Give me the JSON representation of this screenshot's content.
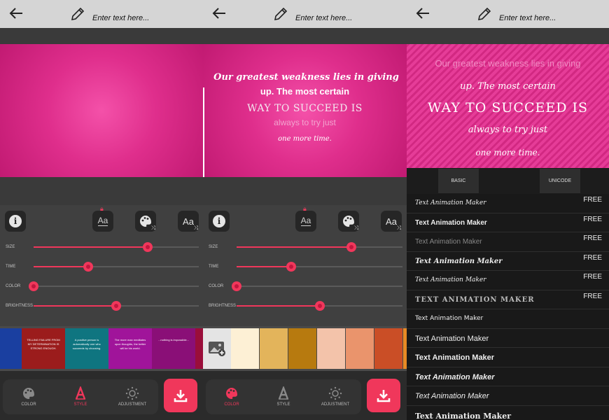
{
  "topbar": {
    "placeholder": "Enter text here..."
  },
  "quote": {
    "line1": "Our greatest weakness lies in giving",
    "line2": "up. The most certain",
    "line3": "WAY TO SUCCEED IS",
    "line4": "always to try just",
    "line5": "one more time."
  },
  "sliders": [
    {
      "label": "SIZE",
      "value": 0.7
    },
    {
      "label": "TIME",
      "value": 0.33
    },
    {
      "label": "COLOR",
      "value": 0.0
    },
    {
      "label": "BRIGHTNESS",
      "value": 0.5
    }
  ],
  "panel1_sliders": [
    0.69,
    0.33,
    0.0,
    0.5
  ],
  "panel2_sliders": [
    0.69,
    0.33,
    0.0,
    0.5
  ],
  "style_thumbs": [
    {
      "bg": "#1a3fa0",
      "text": ""
    },
    {
      "bg": "#9b1c1c",
      "text": "TELLING FAILURE FROM MY DETERMINATION IS STRONG ENOUGH."
    },
    {
      "bg": "#0f7580",
      "text": "A positive person is automatically one who succeeds by choosing."
    },
    {
      "bg": "#a0149a",
      "text": "The more man meditates upon thoughts, the better will be his world."
    },
    {
      "bg": "#8a0f77",
      "text": "...nothing is impossible..."
    },
    {
      "bg": "#9a0e3a",
      "text": ""
    }
  ],
  "swatches": [
    "#fdf0d5",
    "#e3b45b",
    "#b77a0f",
    "#f3c3aa",
    "#ea946c",
    "#ca4e26",
    "#e88a24"
  ],
  "nav": {
    "color": "COLOR",
    "style": "STYLE",
    "adjustment": "ADJUSTMENT"
  },
  "tabs": {
    "basic": "BASIC",
    "unicode": "UNICODE"
  },
  "font_list": [
    {
      "label": "Text Animation Maker",
      "badge": "FREE"
    },
    {
      "label": "Text Animation Maker",
      "badge": "FREE"
    },
    {
      "label": "Text Animation Maker",
      "badge": "FREE"
    },
    {
      "label": "Text Animation Maker",
      "badge": "FREE"
    },
    {
      "label": "Text Animation Maker",
      "badge": "FREE"
    },
    {
      "label": "TEXT ANIMATION MAKER",
      "badge": "FREE"
    },
    {
      "label": "Text Animation Maker",
      "badge": ""
    },
    {
      "label": "Text Animation Maker",
      "badge": ""
    },
    {
      "label": "Text Animation Maker",
      "badge": ""
    },
    {
      "label": "Text Animation Maker",
      "badge": ""
    },
    {
      "label": "Text Animation Maker",
      "badge": ""
    },
    {
      "label": "Text Animation Maker",
      "badge": ""
    }
  ],
  "colors": {
    "accent": "#f0375b",
    "canvas": "#df2e8c"
  },
  "icons": [
    "back-arrow-icon",
    "pencil-icon",
    "info-icon",
    "text-style-icon",
    "palette-shuffle-icon",
    "font-shuffle-icon",
    "lock-icon",
    "add-image-icon",
    "download-icon"
  ]
}
